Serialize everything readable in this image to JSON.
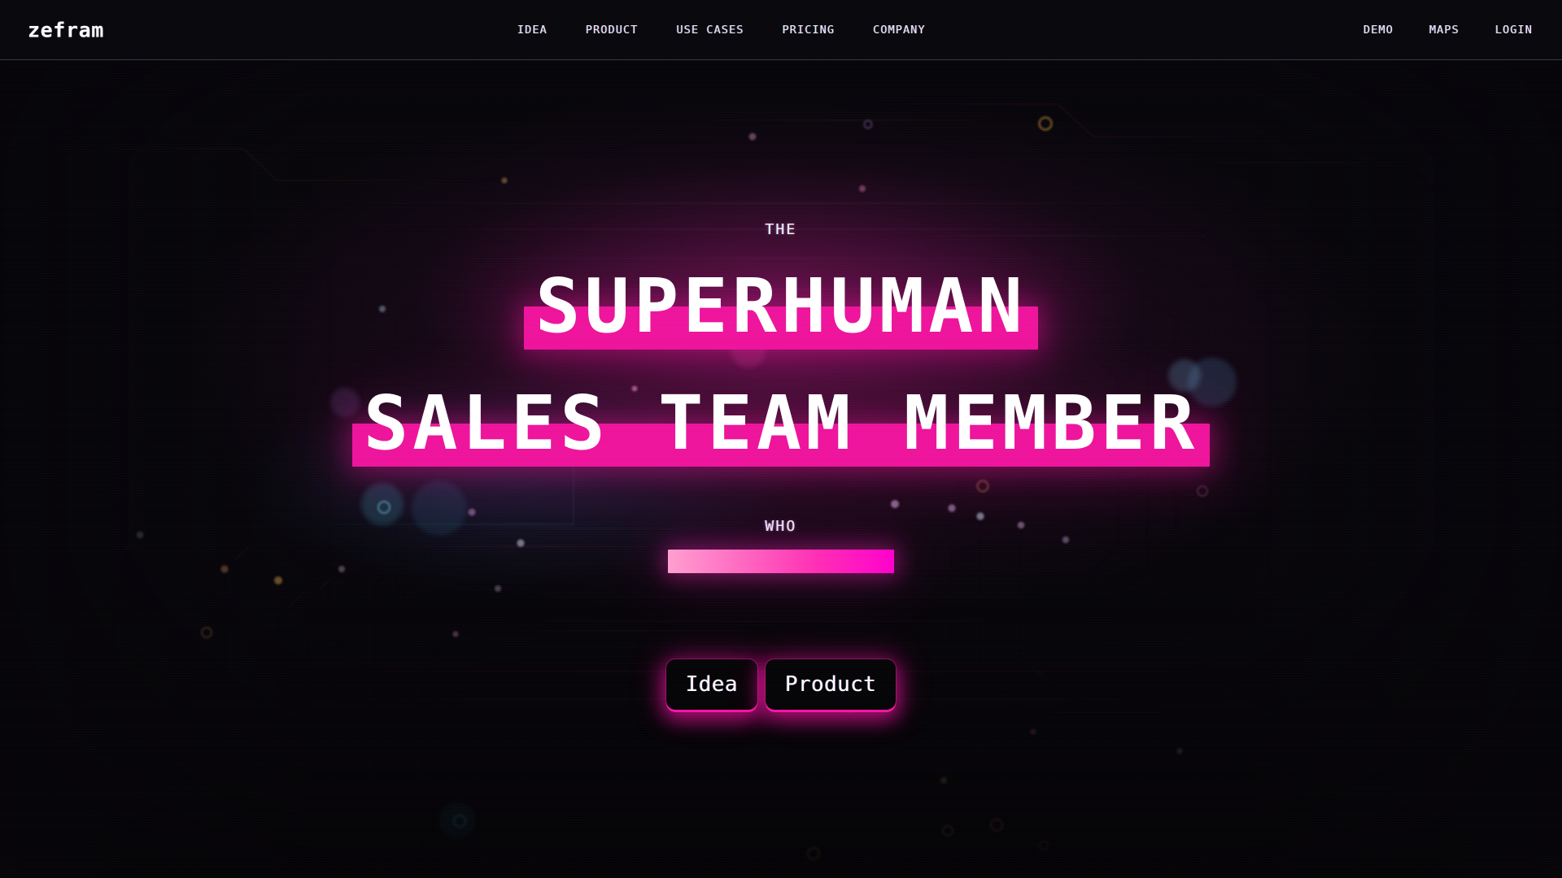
{
  "brand": {
    "logo": "zefram"
  },
  "header": {
    "nav_center": [
      {
        "label": "IDEA",
        "name": "nav-idea"
      },
      {
        "label": "PRODUCT",
        "name": "nav-product"
      },
      {
        "label": "USE CASES",
        "name": "nav-use-cases"
      },
      {
        "label": "PRICING",
        "name": "nav-pricing"
      },
      {
        "label": "COMPANY",
        "name": "nav-company"
      }
    ],
    "nav_right": [
      {
        "label": "DEMO",
        "name": "nav-demo"
      },
      {
        "label": "MAPS",
        "name": "nav-maps"
      },
      {
        "label": "LOGIN",
        "name": "nav-login"
      }
    ]
  },
  "hero": {
    "kicker_top": "THE",
    "headline_line1": "SUPERHUMAN",
    "headline_line2": "SALES TEAM MEMBER",
    "kicker_bottom": "WHO",
    "typing_bar_value": ""
  },
  "cta": {
    "primary_label": "Idea",
    "secondary_label": "Product"
  },
  "colors": {
    "background": "#08060b",
    "header_bg": "#0a090d",
    "header_border": "#3a3a40",
    "accent_magenta": "#ee149c",
    "accent_pink_light": "#ff9fd0",
    "accent_pink_deep": "#ff00cc",
    "text_primary": "#ffffff",
    "nav_text": "#e9e9ef"
  }
}
